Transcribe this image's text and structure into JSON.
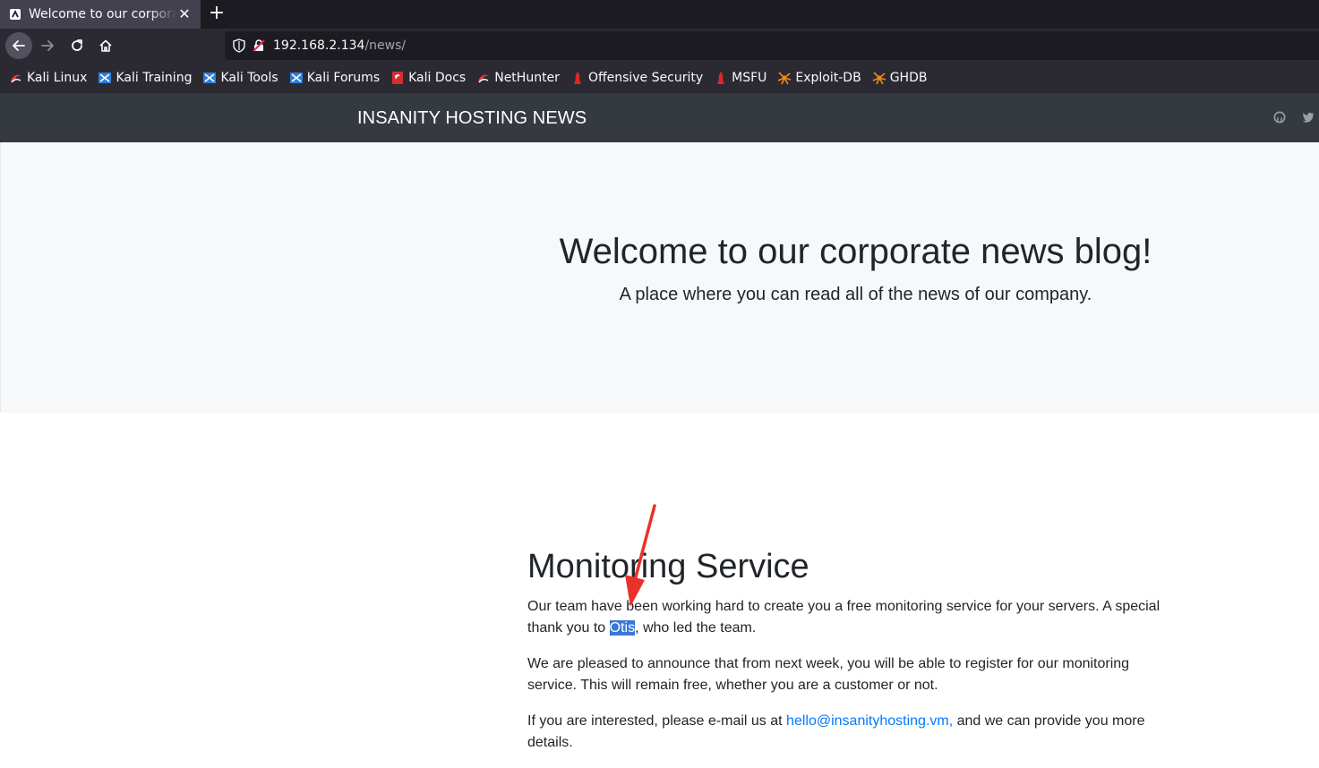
{
  "browser": {
    "tab": {
      "title": "Welcome to our corporate news blog!",
      "close_glyph": "✕"
    },
    "new_tab_glyph": "+",
    "url": {
      "host": "192.168.2.134",
      "path": "/news/"
    },
    "bookmarks": [
      {
        "label": "Kali Linux",
        "icon": "kali-dragon-icon"
      },
      {
        "label": "Kali Training",
        "icon": "kali-training-icon"
      },
      {
        "label": "Kali Tools",
        "icon": "kali-tools-icon"
      },
      {
        "label": "Kali Forums",
        "icon": "kali-forums-icon"
      },
      {
        "label": "Kali Docs",
        "icon": "kali-docs-icon"
      },
      {
        "label": "NetHunter",
        "icon": "nethunter-icon"
      },
      {
        "label": "Offensive Security",
        "icon": "offsec-icon"
      },
      {
        "label": "MSFU",
        "icon": "msfu-icon"
      },
      {
        "label": "Exploit-DB",
        "icon": "exploitdb-icon"
      },
      {
        "label": "GHDB",
        "icon": "ghdb-icon"
      }
    ]
  },
  "site": {
    "brand": "INSANITY HOSTING NEWS",
    "social": [
      "github-icon",
      "twitter-icon"
    ]
  },
  "jumbotron": {
    "title": "Welcome to our corporate news blog!",
    "subtitle": "A place where you can read all of the news of our company."
  },
  "article": {
    "title": "Monitoring Service",
    "p1_before": "Our team have been working hard to create you a free monitoring service for your servers. A special thank you to ",
    "p1_highlight": "Otis",
    "p1_after": ", who led the team.",
    "p2": "We are pleased to announce that from next week, you will be able to register for our monitoring service. This will remain free, whether you are a customer or not.",
    "p3_before": "If you are interested, please e-mail us at ",
    "p3_link": "hello@insanityhosting.vm,",
    "p3_after": " and we can provide you more details."
  },
  "colors": {
    "page_nav": "#343a40",
    "jumbotron_bg": "#f7f8f9",
    "link": "#007bff",
    "selection": "#3a78d6",
    "annotation_arrow": "#e8332a"
  }
}
